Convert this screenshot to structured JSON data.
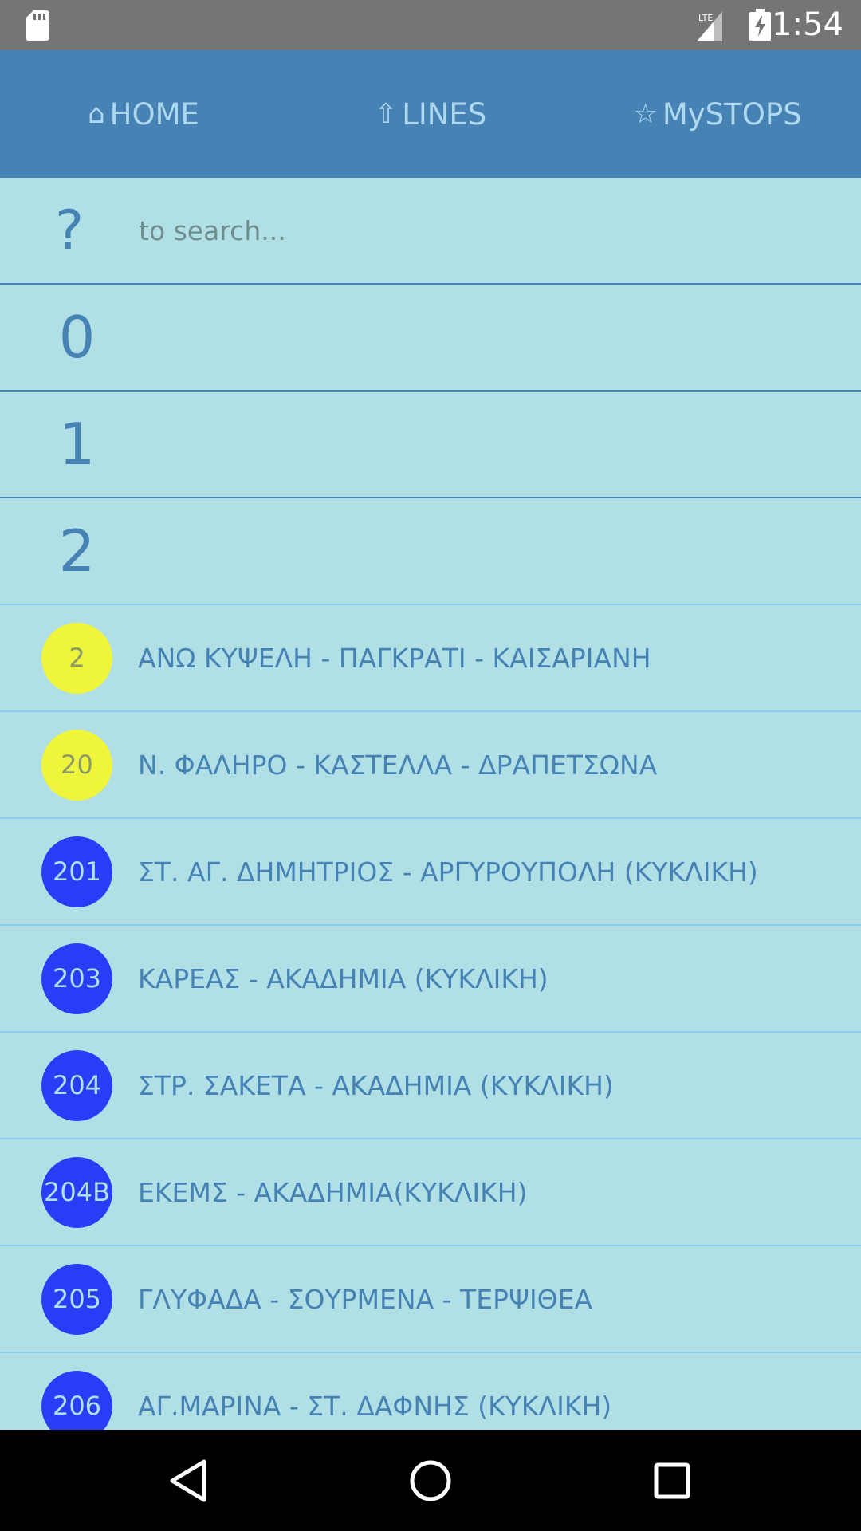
{
  "status_bar": {
    "time": "1:54",
    "network_label": "LTE",
    "icons": [
      "sd-card-icon",
      "lte-signal-icon",
      "battery-charging-icon"
    ]
  },
  "tabs": [
    {
      "icon": "⌂",
      "label": "HOME",
      "icon_name": "home-icon"
    },
    {
      "icon": "⇧",
      "label": "LINES",
      "icon_name": "arrow-up-icon"
    },
    {
      "icon": "☆",
      "label": "MySTOPS",
      "icon_name": "star-icon"
    }
  ],
  "search": {
    "symbol": "?",
    "placeholder": "to search..."
  },
  "sections": [
    "0",
    "1",
    "2"
  ],
  "lines": [
    {
      "number": "2",
      "name": "ΑΝΩ ΚΥΨΕΛΗ - ΠΑΓΚΡΑΤΙ - ΚΑΙΣΑΡΙΑΝΗ",
      "color": "yellow"
    },
    {
      "number": "20",
      "name": "Ν. ΦΑΛΗΡΟ - ΚΑΣΤΕΛΛΑ - ΔΡΑΠΕΤΣΩΝΑ",
      "color": "yellow"
    },
    {
      "number": "201",
      "name": "ΣΤ. ΑΓ. ΔΗΜΗΤΡΙΟΣ - ΑΡΓΥΡΟΥΠΟΛΗ (ΚΥΚΛΙΚΗ)",
      "color": "blue"
    },
    {
      "number": "203",
      "name": "ΚΑΡΕΑΣ - ΑΚΑΔΗΜΙΑ (ΚΥΚΛΙΚΗ)",
      "color": "blue"
    },
    {
      "number": "204",
      "name": "ΣΤΡ. ΣΑΚΕΤΑ - ΑΚΑΔΗΜΙΑ (ΚΥΚΛΙΚΗ)",
      "color": "blue"
    },
    {
      "number": "204Β",
      "name": "ΕΚΕΜΣ - ΑΚΑΔΗΜΙΑ(ΚΥΚΛΙΚΗ)",
      "color": "blue"
    },
    {
      "number": "205",
      "name": "ΓΛΥΦΑΔΑ - ΣΟΥΡΜΕΝΑ - ΤΕΡΨΙΘΕΑ",
      "color": "blue"
    },
    {
      "number": "206",
      "name": "ΑΓ.ΜΑΡΙΝΑ - ΣΤ. ΔΑΦΝΗΣ (ΚΥΚΛΙΚΗ)",
      "color": "blue"
    }
  ],
  "colors": {
    "header": "#4682b4",
    "background": "#b0e0e6",
    "badge_yellow": "#eef53a",
    "badge_blue": "#2a3cf5",
    "text": "#4682b4"
  },
  "system_nav": [
    "back-icon",
    "home-circle-icon",
    "recents-icon"
  ]
}
